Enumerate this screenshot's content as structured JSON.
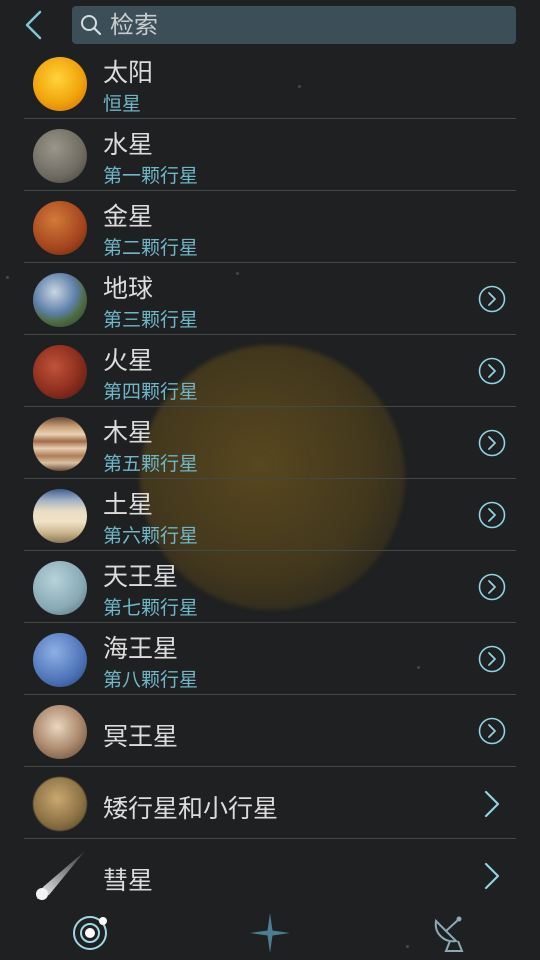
{
  "search": {
    "placeholder": "检索"
  },
  "icons": {
    "back": "chevron-left-icon",
    "search": "magnifier-icon",
    "detail": "circle-arrow-right-icon",
    "more": "chevron-right-icon"
  },
  "colors": {
    "accent": "#6fb6c8",
    "search_bg": "#3c4f58",
    "background": "#1f2021"
  },
  "items": [
    {
      "name": "太阳",
      "subtitle": "恒星",
      "has_detail": false
    },
    {
      "name": "水星",
      "subtitle": "第一颗行星",
      "has_detail": false
    },
    {
      "name": "金星",
      "subtitle": "第二颗行星",
      "has_detail": false
    },
    {
      "name": "地球",
      "subtitle": "第三颗行星",
      "has_detail": true
    },
    {
      "name": "火星",
      "subtitle": "第四颗行星",
      "has_detail": true
    },
    {
      "name": "木星",
      "subtitle": "第五颗行星",
      "has_detail": true
    },
    {
      "name": "土星",
      "subtitle": "第六颗行星",
      "has_detail": true
    },
    {
      "name": "天王星",
      "subtitle": "第七颗行星",
      "has_detail": true
    },
    {
      "name": "海王星",
      "subtitle": "第八颗行星",
      "has_detail": true
    },
    {
      "name": "冥王星",
      "has_detail": true
    },
    {
      "name": "矮行星和小行星",
      "has_more": true
    },
    {
      "name": "彗星",
      "has_more": true
    }
  ],
  "tabs": [
    {
      "icon": "solar-system-icon",
      "selected": true
    },
    {
      "icon": "star-sparkle-icon",
      "selected": false
    },
    {
      "icon": "satellite-dish-icon",
      "selected": false
    }
  ]
}
